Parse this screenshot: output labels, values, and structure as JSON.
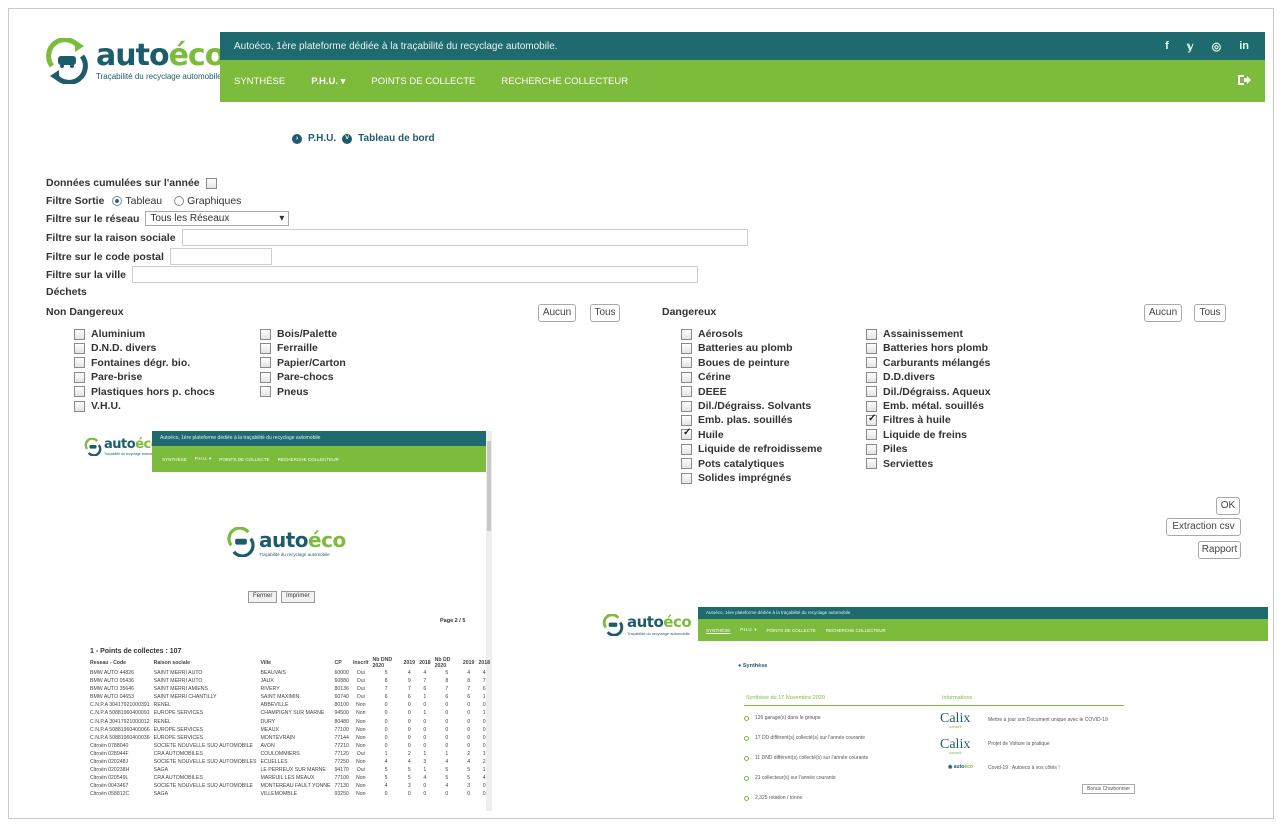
{
  "brand": {
    "name_part1": "auto",
    "name_part2": "éco",
    "tagline": "Traçabilité du recyclage automobile"
  },
  "header": {
    "topbar_text": "Autoéco, 1ère plateforme dédiée à la traçabilité du recyclage automobile.",
    "social": [
      "f",
      "𝕪",
      "◎",
      "in"
    ],
    "nav": [
      {
        "label": "SYNTHÈSE",
        "active": false
      },
      {
        "label": "P.H.U. ▾",
        "active": true
      },
      {
        "label": "POINTS DE COLLECTE",
        "active": false
      },
      {
        "label": "RECHERCHE COLLECTEUR",
        "active": false
      }
    ]
  },
  "breadcrumb": [
    "P.H.U.",
    "Tableau de bord"
  ],
  "filters": {
    "cumulative_label": "Données cumulées sur l'année",
    "output_label": "Filtre Sortie",
    "output_options": [
      "Tableau",
      "Graphiques"
    ],
    "output_selected": "Tableau",
    "network_label": "Filtre sur le réseau",
    "network_value": "Tous les Réseaux",
    "company_label": "Filtre sur la raison sociale",
    "postal_label": "Filtre sur le code postal",
    "city_label": "Filtre sur la ville",
    "waste_label": "Déchets"
  },
  "non_dangerous": {
    "title": "Non Dangereux",
    "btn_none": "Aucun",
    "btn_all": "Tous",
    "col1": [
      "Aluminium",
      "D.N.D. divers",
      "Fontaines dégr. bio.",
      "Pare-brise",
      "Plastiques hors p. chocs",
      "V.H.U."
    ],
    "col2": [
      "Bois/Palette",
      "Ferraille",
      "Papier/Carton",
      "Pare-chocs",
      "Pneus"
    ]
  },
  "dangerous": {
    "title": "Dangereux",
    "btn_none": "Aucun",
    "btn_all": "Tous",
    "col1": [
      "Aérosols",
      "Batteries au plomb",
      "Boues de peinture",
      "Cérine",
      "DEEE",
      "Dil./Dégraiss. Solvants",
      "Emb. plas. souillés",
      "Huile",
      "Liquide de refroidisseme",
      "Pots catalytiques",
      "Solides imprégnés"
    ],
    "col1_checked": [
      false,
      false,
      false,
      false,
      false,
      false,
      false,
      true,
      false,
      false,
      false
    ],
    "col2": [
      "Assainissement",
      "Batteries hors plomb",
      "Carburants mélangés",
      "D.D.divers",
      "Dil./Dégraiss. Aqueux",
      "Emb. métal. souillés",
      "Filtres à huile",
      "Liquide de freins",
      "Piles",
      "Serviettes"
    ],
    "col2_checked": [
      false,
      false,
      false,
      false,
      false,
      false,
      true,
      false,
      false,
      false
    ]
  },
  "actions": {
    "ok": "OK",
    "csv": "Extraction csv",
    "report": "Rapport"
  },
  "report_preview": {
    "topbar_text": "Autoéco, 1ère plateforme dédiée à la traçabilité du recyclage automobile",
    "nav": [
      "SYNTHÈSE",
      "P.H.U. ▾",
      "POINTS DE COLLECTE",
      "RECHERCHE COLLECTEUR"
    ],
    "btn_close": "Fermer",
    "btn_print": "Imprimer",
    "page": "Page 2 / 5",
    "title": "1 - Points de collectes : 107",
    "headers": [
      "Reseau - Code",
      "Raison sociale",
      "Ville",
      "CP",
      "Inscrit",
      "Nb DND 2020",
      "2019",
      "2018",
      "Nb DD 2020",
      "2019",
      "2018"
    ],
    "rows": [
      [
        "BMW AUTO 44826",
        "SAINT MERRI AUTO",
        "BEAUVAIS",
        "60000",
        "Oui",
        "5",
        "4",
        "4",
        "5",
        "4",
        "4"
      ],
      [
        "BMW AUTO 05436",
        "SAINT MERRI AUTO",
        "JAUX",
        "60880",
        "Oui",
        "8",
        "9",
        "7",
        "8",
        "8",
        "7"
      ],
      [
        "BMW AUTO 35646",
        "SAINT MERRI AMIENS",
        "RIVERY",
        "80136",
        "Oui",
        "7",
        "7",
        "6",
        "7",
        "7",
        "6"
      ],
      [
        "BMW AUTO 04653",
        "SAINT MERRI CHANTILLY",
        "SAINT MAXIMIN",
        "60740",
        "Oui",
        "6",
        "6",
        "1",
        "6",
        "6",
        "1"
      ],
      [
        "C.N.P.A 30417921000391",
        "RENEL",
        "ABBEVILLE",
        "80100",
        "Non",
        "0",
        "0",
        "0",
        "0",
        "0",
        "0"
      ],
      [
        "C.N.P.A 50881960400091",
        "EUROPE SERVICES",
        "CHAMPIGNY SUR MARNE",
        "94500",
        "Non",
        "0",
        "0",
        "1",
        "0",
        "0",
        "1"
      ],
      [
        "C.N.P.A 30417921000012",
        "RENEL",
        "DURY",
        "80480",
        "Non",
        "0",
        "0",
        "0",
        "0",
        "0",
        "0"
      ],
      [
        "C.N.P.A 50881960400066",
        "EUROPE SERVICES",
        "MEAUX",
        "77100",
        "Non",
        "0",
        "0",
        "0",
        "0",
        "0",
        "0"
      ],
      [
        "C.N.P.A 50881960400036",
        "EUROPE SERVICES",
        "MONTEVRAIN",
        "77144",
        "Non",
        "0",
        "0",
        "0",
        "0",
        "0",
        "0"
      ],
      [
        "Citroën 0788040",
        "SOCIETE NOUVELLE SUD AUTOMOBILE",
        "AVON",
        "77210",
        "Non",
        "0",
        "0",
        "0",
        "0",
        "0",
        "0"
      ],
      [
        "Citroën 028944F",
        "CRA AUTOMOBILES",
        "COULOMMIERS",
        "77120",
        "Oui",
        "1",
        "2",
        "1",
        "1",
        "2",
        "1"
      ],
      [
        "Citroën 020248J",
        "SOCIETE NOUVELLE SUD AUTOMOBILES",
        "ECUELLES",
        "77250",
        "Non",
        "4",
        "4",
        "3",
        "4",
        "4",
        "2"
      ],
      [
        "Citroën 020238H",
        "SAGA",
        "LE PERREUX SUR MARNE",
        "94170",
        "Oui",
        "5",
        "5",
        "1",
        "5",
        "5",
        "1"
      ],
      [
        "Citroën 020549L",
        "CRA AUTOMOBILES",
        "MAREUIL LES MEAUX",
        "77100",
        "Non",
        "5",
        "5",
        "4",
        "5",
        "5",
        "4"
      ],
      [
        "Citroën 0043467",
        "SOCIETE NOUVELLE SUD AUTOMOBILE",
        "MONTEREAU FAULT YONNE",
        "77130",
        "Non",
        "4",
        "3",
        "0",
        "4",
        "3",
        "0"
      ],
      [
        "Citroën 058812C",
        "SAGA",
        "VILLEMOMBLE",
        "93250",
        "Non",
        "0",
        "0",
        "0",
        "0",
        "0",
        "0"
      ]
    ]
  },
  "synthese_preview": {
    "topbar_text": "Autoéco, 1ère plateforme dédiée à la traçabilité du recyclage automobile",
    "nav": [
      "SYNTHÈSE",
      "P.H.U. ▾",
      "POINTS DE COLLECTE",
      "RECHERCHE COLLECTEUR"
    ],
    "crumb": "Synthèse",
    "summary_title": "Synthèse du 17 Novembre 2020",
    "info_title": "Informations",
    "stats": [
      "126 garage(s) dans le groupe",
      "17 DD différent(s) collecté(s) sur l'année courante",
      "11 DND différent(s) collecté(s) sur l'année courante",
      "21 collecteur(s) sur l'année courante",
      "2,325 rotation / tonne"
    ],
    "infos": [
      "Mettre à jour son Document unique avec le COVID-19",
      "Projet de Voiture la pratique",
      "Covid-19 : Autoeco à vos côtés !"
    ],
    "calix": "Calix",
    "calix_sub": "conseil",
    "bonus": "Bonus Charbonnier"
  }
}
